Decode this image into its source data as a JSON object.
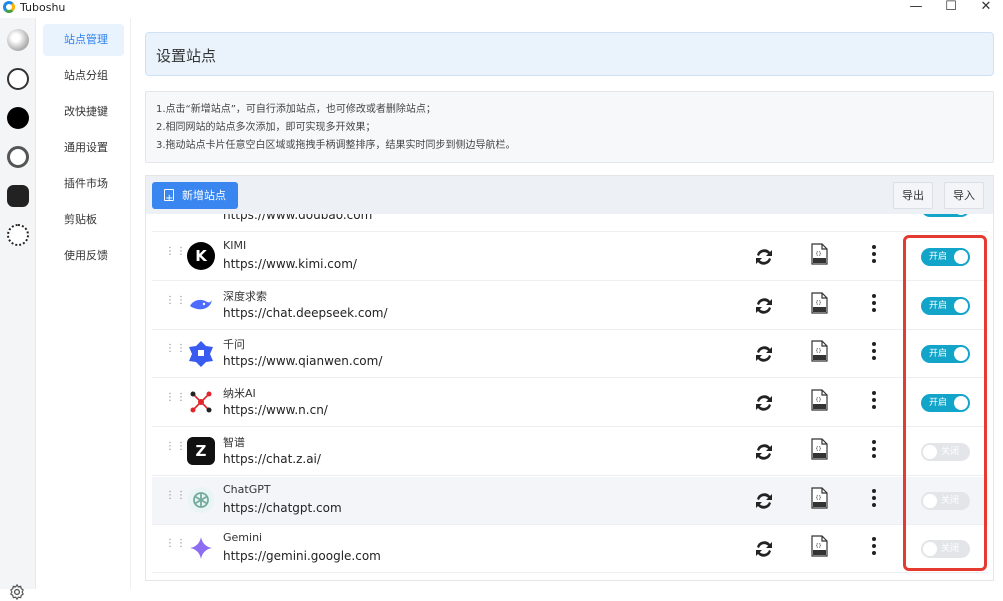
{
  "app": {
    "title": "Tuboshu"
  },
  "window_controls": {
    "minimize": "—",
    "maximize": "☐",
    "close": "✕"
  },
  "sidebar": {
    "items": [
      {
        "label": "站点管理",
        "active": true
      },
      {
        "label": "站点分组"
      },
      {
        "label": "改快捷键"
      },
      {
        "label": "通用设置"
      },
      {
        "label": "插件市场"
      },
      {
        "label": "剪贴板"
      },
      {
        "label": "使用反馈"
      }
    ]
  },
  "page": {
    "title": "设置站点",
    "tips": [
      "1.点击“新增站点”，可自行添加站点，也可修改或者删除站点；",
      "2.相同网站的站点多次添加，即可实现多开效果；",
      "3.拖动站点卡片任意空白区域或拖拽手柄调整排序，结果实时同步到侧边导航栏。"
    ]
  },
  "toolbar": {
    "add_label": "新增站点",
    "export_label": "导出",
    "import_label": "导入"
  },
  "sites": [
    {
      "name": "",
      "url": "https://www.doubao.com",
      "enabled": true,
      "toggle_label": "开启",
      "logo": "doubao-logo",
      "logo_color": "#444444"
    },
    {
      "name": "KIMI",
      "url": "https://www.kimi.com/",
      "enabled": true,
      "toggle_label": "开启",
      "logo": "kimi-logo",
      "logo_color": "#000000",
      "logo_glyph": "K"
    },
    {
      "name": "深度求索",
      "url": "https://chat.deepseek.com/",
      "enabled": true,
      "toggle_label": "开启",
      "logo": "deepseek-logo",
      "logo_color": "#4d6bfe"
    },
    {
      "name": "千问",
      "url": "https://www.qianwen.com/",
      "enabled": true,
      "toggle_label": "开启",
      "logo": "qianwen-logo",
      "logo_color": "#3a5bf0"
    },
    {
      "name": "纳米AI",
      "url": "https://www.n.cn/",
      "enabled": true,
      "toggle_label": "开启",
      "logo": "nami-logo",
      "logo_color": "#e0262b"
    },
    {
      "name": "智谱",
      "url": "https://chat.z.ai/",
      "enabled": false,
      "toggle_label": "关闭",
      "logo": "zhipu-logo",
      "logo_color": "#111111",
      "logo_glyph": "Z"
    },
    {
      "name": "ChatGPT",
      "url": "https://chatgpt.com",
      "enabled": false,
      "toggle_label": "关闭",
      "logo": "chatgpt-logo",
      "logo_color": "#74aa9c"
    },
    {
      "name": "Gemini",
      "url": "https://gemini.google.com",
      "enabled": false,
      "toggle_label": "关闭",
      "logo": "gemini-logo",
      "logo_color": "#8c6cf0"
    }
  ],
  "colors": {
    "accent": "#3a86f0",
    "toggle_on": "#13a5c9",
    "toggle_off": "#e3e5e8",
    "highlight_box": "#e53a2f"
  }
}
